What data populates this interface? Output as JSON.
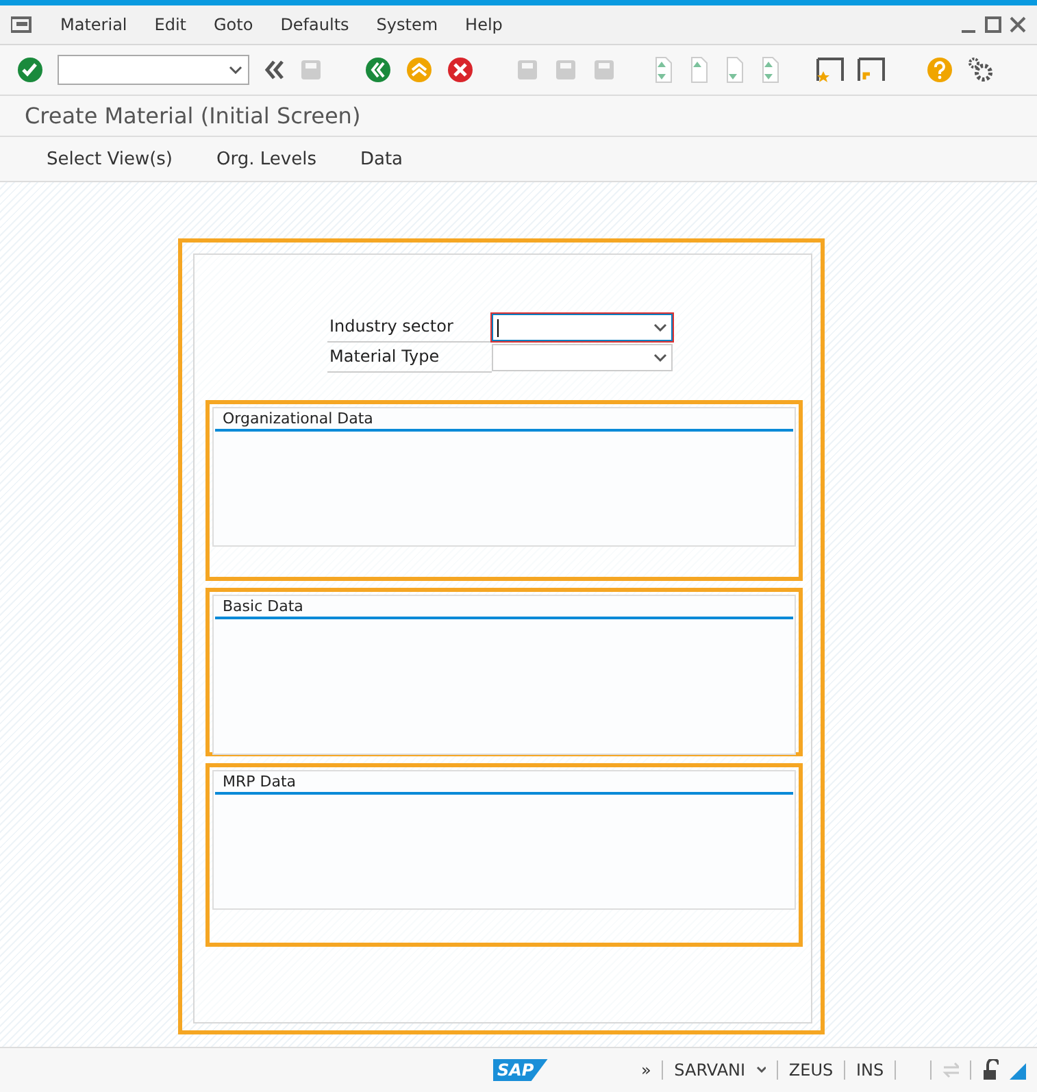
{
  "menu": [
    "Material",
    "Edit",
    "Goto",
    "Defaults",
    "System",
    "Help"
  ],
  "screen_title": "Create Material (Initial Screen)",
  "app_toolbar": [
    "Select View(s)",
    "Org. Levels",
    "Data"
  ],
  "fields": [
    {
      "label": "Industry sector",
      "focused": true
    },
    {
      "label": "Material Type",
      "focused": false
    }
  ],
  "groups": [
    {
      "title": "Organizational Data"
    },
    {
      "title": "Basic Data"
    },
    {
      "title": "MRP Data"
    }
  ],
  "status_bar": {
    "logo": "SAP",
    "more": "»",
    "user": "SARVANI",
    "system": "ZEUS",
    "mode": "INS"
  }
}
